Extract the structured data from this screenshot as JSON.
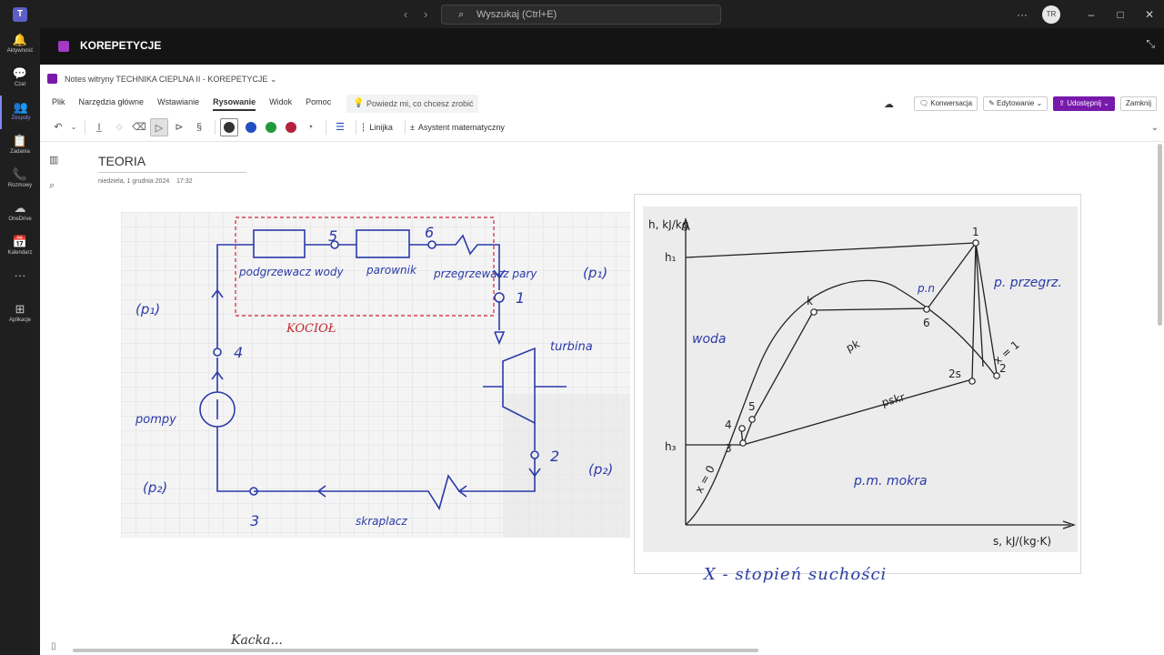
{
  "titlebar": {
    "search_placeholder": "Wyszukaj (Ctrl+E)",
    "avatar_initials": "TR",
    "back": "‹",
    "forward": "›"
  },
  "rail": [
    {
      "label": "Aktywność",
      "glyph": "🔔"
    },
    {
      "label": "Czat",
      "glyph": "💬"
    },
    {
      "label": "Zespoły",
      "glyph": "👥"
    },
    {
      "label": "Zadania",
      "glyph": "📋"
    },
    {
      "label": "Rozmowy",
      "glyph": "📞"
    },
    {
      "label": "OneDrive",
      "glyph": "☁"
    },
    {
      "label": "Kalendarz",
      "glyph": "📅"
    },
    {
      "label": "",
      "glyph": "···"
    },
    {
      "label": "Aplikacje",
      "glyph": "⊞"
    }
  ],
  "header": {
    "title": "KOREPETYCJE"
  },
  "breadcrumb": "Notes witryny TECHNIKA CIEPLNA II - KOREPETYCJE",
  "ribbon": {
    "tabs": [
      "Plik",
      "Narzędzia główne",
      "Wstawianie",
      "Rysowanie",
      "Widok",
      "Pomoc"
    ],
    "active_tab": "Rysowanie",
    "tell_me": "Powiedz mi, co chcesz zrobić",
    "conversation": "Konwersacja",
    "editing": "Edytowanie",
    "share": "Udostępnij",
    "close": "Zamknij"
  },
  "toolbar": {
    "ruler": "Linijka",
    "math": "Asystent matematyczny"
  },
  "pens": [
    "#333333",
    "#1f4fc1",
    "#1f9a3a",
    "#b5203c"
  ],
  "page": {
    "title": "TEORIA",
    "date": "niedziela, 1 grudnia 2024",
    "time": "17:32"
  },
  "sketch": {
    "labels": {
      "heater": "podgrzewacz wody",
      "evaporator": "parownik",
      "superheater": "przegrzewacz pary",
      "boiler": "KOCIOŁ",
      "turbine": "turbina",
      "pump": "pompy",
      "condenser": "skraplacz",
      "p1_left": "(p₁)",
      "p1_right": "(p₁)",
      "p2_right": "(p₂)",
      "p2_left": "(p₂)",
      "n1": "1",
      "n2": "2",
      "n3": "3",
      "n4": "4",
      "n5": "5",
      "n6": "6"
    }
  },
  "diagram": {
    "y_axis": "h, kJ/kg",
    "x_axis": "s, kJ/(kg·K)",
    "h1": "h₁",
    "h3": "h₃",
    "points": {
      "p1": "1",
      "p2": "2",
      "p2s": "2s",
      "p3": "3",
      "p4": "4",
      "p5": "5",
      "p6": "6",
      "k": "k"
    },
    "pk": "pk",
    "pskr": "pskr",
    "x0": "x = 0",
    "x1": "x = 1",
    "ink": {
      "water": "woda",
      "steam": "p.n",
      "superheated": "p. przegrz.",
      "wet": "p.m. mokra"
    }
  },
  "ink_note": "X - stopień suchości",
  "ink_bottom": "Kacka..."
}
